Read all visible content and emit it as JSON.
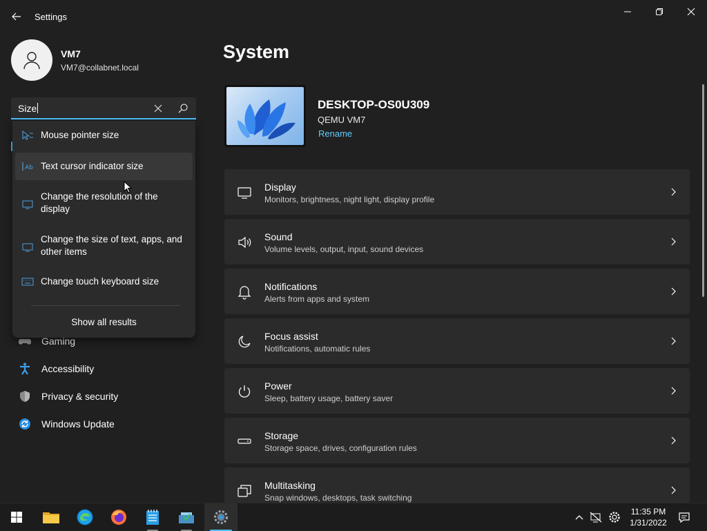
{
  "window": {
    "title": "Settings"
  },
  "profile": {
    "name": "VM7",
    "email": "VM7@collabnet.local"
  },
  "search": {
    "value": "Size",
    "suggestions": [
      {
        "label": "Mouse pointer size",
        "icon": "mouse-pointer-icon"
      },
      {
        "label": "Text cursor indicator size",
        "icon": "text-cursor-icon"
      },
      {
        "label": "Change the resolution of the display",
        "icon": "display-icon"
      },
      {
        "label": "Change the size of text, apps, and other items",
        "icon": "display-icon"
      },
      {
        "label": "Change touch keyboard size",
        "icon": "keyboard-icon"
      }
    ],
    "show_all": "Show all results"
  },
  "nav": {
    "items": [
      {
        "label": "Gaming",
        "icon": "gaming-icon"
      },
      {
        "label": "Accessibility",
        "icon": "accessibility-icon"
      },
      {
        "label": "Privacy & security",
        "icon": "shield-icon"
      },
      {
        "label": "Windows Update",
        "icon": "windows-update-icon"
      }
    ]
  },
  "main": {
    "title": "System",
    "device": {
      "name": "DESKTOP-OS0U309",
      "model": "QEMU VM7",
      "rename": "Rename"
    },
    "cards": [
      {
        "title": "Display",
        "subtitle": "Monitors, brightness, night light, display profile",
        "icon": "display-icon"
      },
      {
        "title": "Sound",
        "subtitle": "Volume levels, output, input, sound devices",
        "icon": "speaker-icon"
      },
      {
        "title": "Notifications",
        "subtitle": "Alerts from apps and system",
        "icon": "bell-icon"
      },
      {
        "title": "Focus assist",
        "subtitle": "Notifications, automatic rules",
        "icon": "moon-icon"
      },
      {
        "title": "Power",
        "subtitle": "Sleep, battery usage, battery saver",
        "icon": "power-icon"
      },
      {
        "title": "Storage",
        "subtitle": "Storage space, drives, configuration rules",
        "icon": "storage-icon"
      },
      {
        "title": "Multitasking",
        "subtitle": "Snap windows, desktops, task switching",
        "icon": "multitasking-icon"
      }
    ]
  },
  "taskbar": {
    "apps": [
      {
        "name": "start-icon"
      },
      {
        "name": "file-explorer-icon"
      },
      {
        "name": "edge-icon"
      },
      {
        "name": "firefox-icon"
      },
      {
        "name": "notepad-icon"
      },
      {
        "name": "installer-icon"
      },
      {
        "name": "settings-icon",
        "active": true
      }
    ],
    "clock": {
      "time": "11:35 PM",
      "date": "1/31/2022"
    }
  },
  "colors": {
    "accent": "#4cc2ff",
    "link": "#60cdff",
    "background": "#202020",
    "card": "#2b2b2b"
  }
}
